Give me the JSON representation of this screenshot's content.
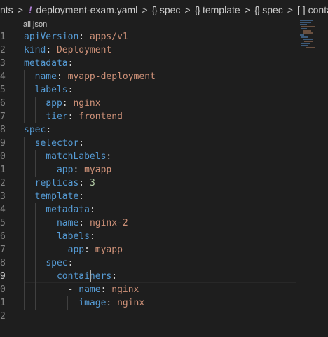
{
  "breadcrumb": {
    "folder": "nts",
    "file_icon": "!",
    "file": "deployment-exam.yaml",
    "crumbs": [
      "spec",
      "template",
      "spec"
    ],
    "last": "containers"
  },
  "tooltip": "all.json",
  "line_numbers": [
    "1",
    "2",
    "3",
    "4",
    "5",
    "6",
    "7",
    "8",
    "9",
    "0",
    "1",
    "2",
    "3",
    "4",
    "5",
    "6",
    "7",
    "8",
    "9",
    "0",
    "1",
    "2"
  ],
  "colors": {
    "key": "#569cd6",
    "string": "#ce9178",
    "number": "#b5cea8",
    "background": "#1e1e1e"
  },
  "code": [
    {
      "indent": "",
      "key": "apiVersion",
      "value": "apps/v1",
      "vtype": "val"
    },
    {
      "indent": "",
      "key": "kind",
      "value": "Deployment",
      "vtype": "val"
    },
    {
      "indent": "",
      "key": "metadata",
      "value": "",
      "vtype": "val"
    },
    {
      "indent": "  ",
      "key": "name",
      "value": "myapp-deployment",
      "vtype": "val"
    },
    {
      "indent": "  ",
      "key": "labels",
      "value": "",
      "vtype": "val"
    },
    {
      "indent": "    ",
      "key": "app",
      "value": "nginx",
      "vtype": "val"
    },
    {
      "indent": "    ",
      "key": "tier",
      "value": "frontend",
      "vtype": "val"
    },
    {
      "indent": "",
      "key": "spec",
      "value": "",
      "vtype": "val"
    },
    {
      "indent": "  ",
      "key": "selector",
      "value": "",
      "vtype": "val"
    },
    {
      "indent": "    ",
      "key": "matchLabels",
      "value": "",
      "vtype": "val"
    },
    {
      "indent": "      ",
      "key": "app",
      "value": "myapp",
      "vtype": "val"
    },
    {
      "indent": "  ",
      "key": "replicas",
      "value": "3",
      "vtype": "num"
    },
    {
      "indent": "  ",
      "key": "template",
      "value": "",
      "vtype": "val"
    },
    {
      "indent": "    ",
      "key": "metadata",
      "value": "",
      "vtype": "val"
    },
    {
      "indent": "      ",
      "key": "name",
      "value": "nginx-2",
      "vtype": "val"
    },
    {
      "indent": "      ",
      "key": "labels",
      "value": "",
      "vtype": "val"
    },
    {
      "indent": "        ",
      "key": "app",
      "value": "myapp",
      "vtype": "val"
    },
    {
      "indent": "    ",
      "key": "spec",
      "value": "",
      "vtype": "val"
    },
    {
      "indent": "      ",
      "key": "containers",
      "value": "",
      "vtype": "val"
    },
    {
      "indent": "        - ",
      "key": "name",
      "value": "nginx",
      "vtype": "val"
    },
    {
      "indent": "          ",
      "key": "image",
      "value": "nginx",
      "vtype": "val"
    },
    {
      "indent": "",
      "key": "",
      "value": "",
      "vtype": "val"
    }
  ]
}
